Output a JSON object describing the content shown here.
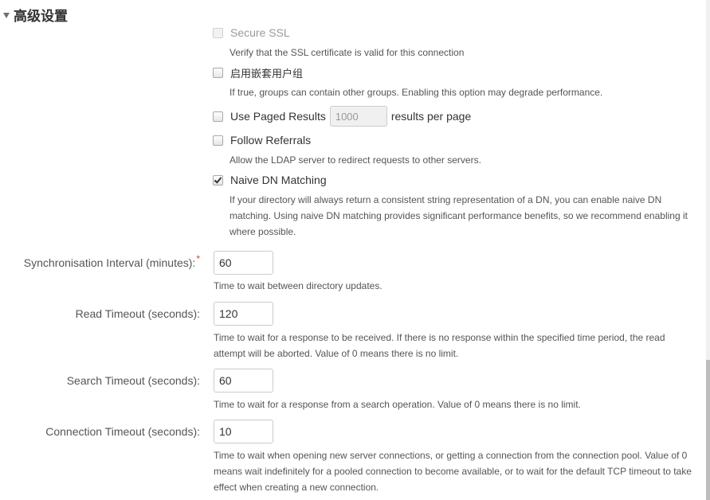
{
  "section": {
    "title": "高级设置",
    "collapse_icon": "triangle-down-icon"
  },
  "options": [
    {
      "label": "Secure SSL",
      "checked": false,
      "disabled": true,
      "description": "Verify that the SSL certificate is valid for this connection"
    },
    {
      "label": "启用嵌套用户组",
      "checked": false,
      "disabled": false,
      "description": "If true, groups can contain other groups. Enabling this option may degrade performance."
    },
    {
      "label": "Use Paged Results",
      "checked": false,
      "disabled": false,
      "input_value": "1000",
      "suffix": "results per page"
    },
    {
      "label": "Follow Referrals",
      "checked": false,
      "disabled": false,
      "description": "Allow the LDAP server to redirect requests to other servers."
    },
    {
      "label": "Naive DN Matching",
      "checked": true,
      "disabled": false,
      "description": "If your directory will always return a consistent string representation of a DN, you can enable naive DN matching. Using naive DN matching provides significant performance benefits, so we recommend enabling it where possible."
    }
  ],
  "fields": [
    {
      "label": "Synchronisation Interval (minutes):",
      "required": true,
      "required_mark": "*",
      "value": "60",
      "description": "Time to wait between directory updates."
    },
    {
      "label": "Read Timeout (seconds):",
      "required": false,
      "value": "120",
      "description": "Time to wait for a response to be received. If there is no response within the specified time period, the read attempt will be aborted. Value of 0 means there is no limit."
    },
    {
      "label": "Search Timeout (seconds):",
      "required": false,
      "value": "60",
      "description": "Time to wait for a response from a search operation. Value of 0 means there is no limit."
    },
    {
      "label": "Connection Timeout (seconds):",
      "required": false,
      "value": "10",
      "description": "Time to wait when opening new server connections, or getting a connection from the connection pool. Value of 0 means wait indefinitely for a pooled connection to become available, or to wait for the default TCP timeout to take effect when creating a new connection."
    }
  ],
  "colors": {
    "required": "#d04437",
    "label": "#555555",
    "text": "#333333"
  }
}
